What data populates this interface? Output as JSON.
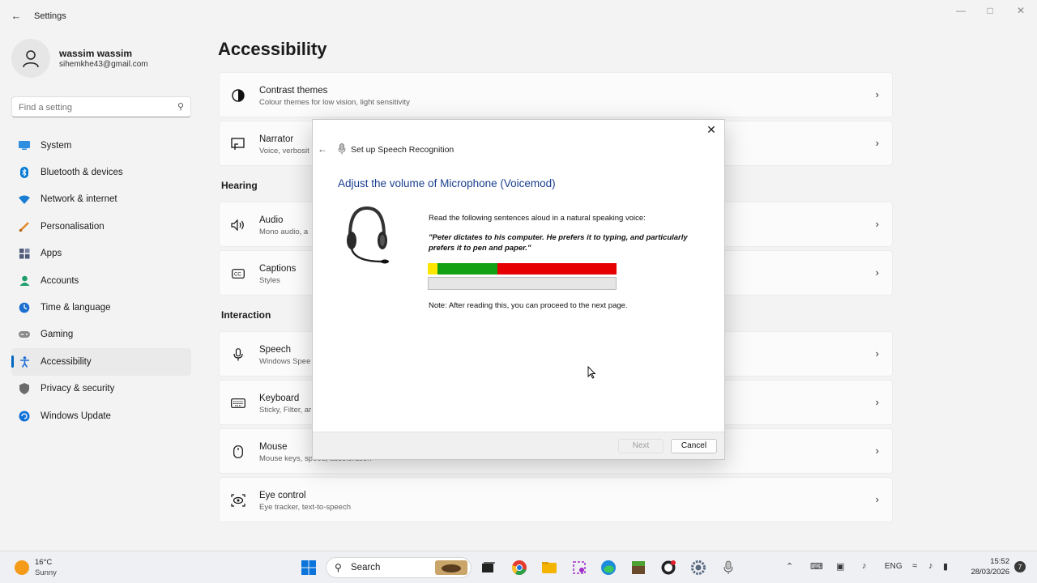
{
  "app": {
    "title": "Settings"
  },
  "profile": {
    "name": "wassim wassim",
    "email": "sihemkhe43@gmail.com"
  },
  "search": {
    "placeholder": "Find a setting"
  },
  "sidebar": {
    "items": [
      {
        "label": "System",
        "icon": "system-icon",
        "color": "#0078d4"
      },
      {
        "label": "Bluetooth & devices",
        "icon": "bluetooth-icon",
        "color": "#0078d4"
      },
      {
        "label": "Network & internet",
        "icon": "wifi-icon",
        "color": "#0a7cd0"
      },
      {
        "label": "Personalisation",
        "icon": "brush-icon",
        "color": "#e08a2c"
      },
      {
        "label": "Apps",
        "icon": "apps-icon",
        "color": "#4f5b79"
      },
      {
        "label": "Accounts",
        "icon": "accounts-icon",
        "color": "#1e9e6b"
      },
      {
        "label": "Time & language",
        "icon": "time-language-icon",
        "color": "#1c6fd0"
      },
      {
        "label": "Gaming",
        "icon": "gaming-icon",
        "color": "#7a7a7a"
      },
      {
        "label": "Accessibility",
        "icon": "accessibility-icon",
        "color": "#1f6fd8",
        "active": true
      },
      {
        "label": "Privacy & security",
        "icon": "shield-icon",
        "color": "#666666"
      },
      {
        "label": "Windows Update",
        "icon": "windows-update-icon",
        "color": "#1072d6"
      }
    ]
  },
  "main": {
    "title": "Accessibility",
    "sections": {
      "hearing": "Hearing",
      "interaction": "Interaction"
    },
    "cards": [
      {
        "title": "Contrast themes",
        "subtitle": "Colour themes for low vision, light sensitivity",
        "icon": "contrast-icon"
      },
      {
        "title": "Narrator",
        "subtitle": "Voice, verbosit",
        "icon": "narrator-icon"
      },
      {
        "title": "Audio",
        "subtitle": "Mono audio, a",
        "icon": "speaker-icon"
      },
      {
        "title": "Captions",
        "subtitle": "Styles",
        "icon": "captions-icon"
      },
      {
        "title": "Speech",
        "subtitle": "Windows Spee",
        "icon": "microphone-icon"
      },
      {
        "title": "Keyboard",
        "subtitle": "Sticky, Filter, ar",
        "icon": "keyboard-icon"
      },
      {
        "title": "Mouse",
        "subtitle": "Mouse keys, speed, acceleration",
        "icon": "mouse-icon"
      },
      {
        "title": "Eye control",
        "subtitle": "Eye tracker, text-to-speech",
        "icon": "eye-control-icon"
      }
    ]
  },
  "dialog": {
    "title": "Set up Speech Recognition",
    "heading": "Adjust the volume of Microphone (Voicemod)",
    "instruction": "Read the following sentences aloud in a natural speaking voice:",
    "quote": "\"Peter dictates to his computer. He prefers it to typing, and particularly prefers it to pen and paper.\"",
    "note": "Note: After reading this, you can proceed to the next page.",
    "level_meter": {
      "yellow": 0.05,
      "green": 0.32,
      "red": 0.63,
      "colors": {
        "yellow": "#ffe600",
        "green": "#12a112",
        "red": "#e60000"
      }
    },
    "progress": 0,
    "buttons": {
      "next": "Next",
      "cancel": "Cancel"
    }
  },
  "taskbar": {
    "weather": {
      "temp": "16°C",
      "condition": "Sunny"
    },
    "search_label": "Search",
    "language": "ENG",
    "time": "15:52",
    "date": "28/03/2026",
    "notifications": "7"
  }
}
